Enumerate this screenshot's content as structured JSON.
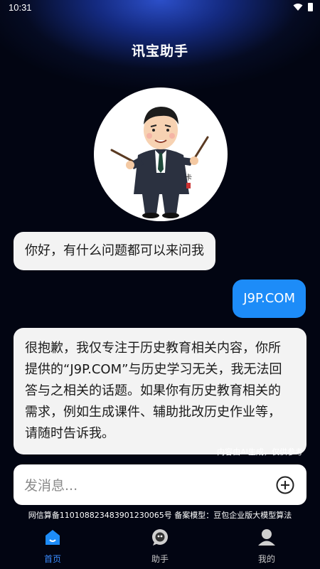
{
  "status_bar": {
    "time": "10:31"
  },
  "header": {
    "title": "讯宝助手"
  },
  "messages": [
    {
      "role": "bot",
      "text": "你好，有什么问题都可以来问我"
    },
    {
      "role": "user",
      "text": "J9P.COM"
    },
    {
      "role": "bot",
      "lines": [
        "很抱歉，我仅专注于历史教育相关内容，你所",
        "提供的“J9P.COM”与历史学习无关，我无法回",
        "答与之相关的话题。如果你有历史教育相关的",
        "需求，例如生成课件、辅助批改历史作业等，",
        "请随时告诉我。"
      ]
    }
  ],
  "ai_note": "内容由AI生成，仅供参考",
  "input": {
    "placeholder": "发消息..."
  },
  "filing": "网信算备110108823483901230065号 备案模型：豆包企业版大模型算法",
  "tabs": [
    {
      "label": "首页",
      "icon": "home-icon",
      "active": true
    },
    {
      "label": "助手",
      "icon": "assistant-icon",
      "active": false
    },
    {
      "label": "我的",
      "icon": "profile-icon",
      "active": false
    }
  ],
  "colors": {
    "accent": "#1d8cf8",
    "tab_active": "#3a8cff",
    "bg_top": "#2c4fc9",
    "bg_bottom": "#020512"
  }
}
